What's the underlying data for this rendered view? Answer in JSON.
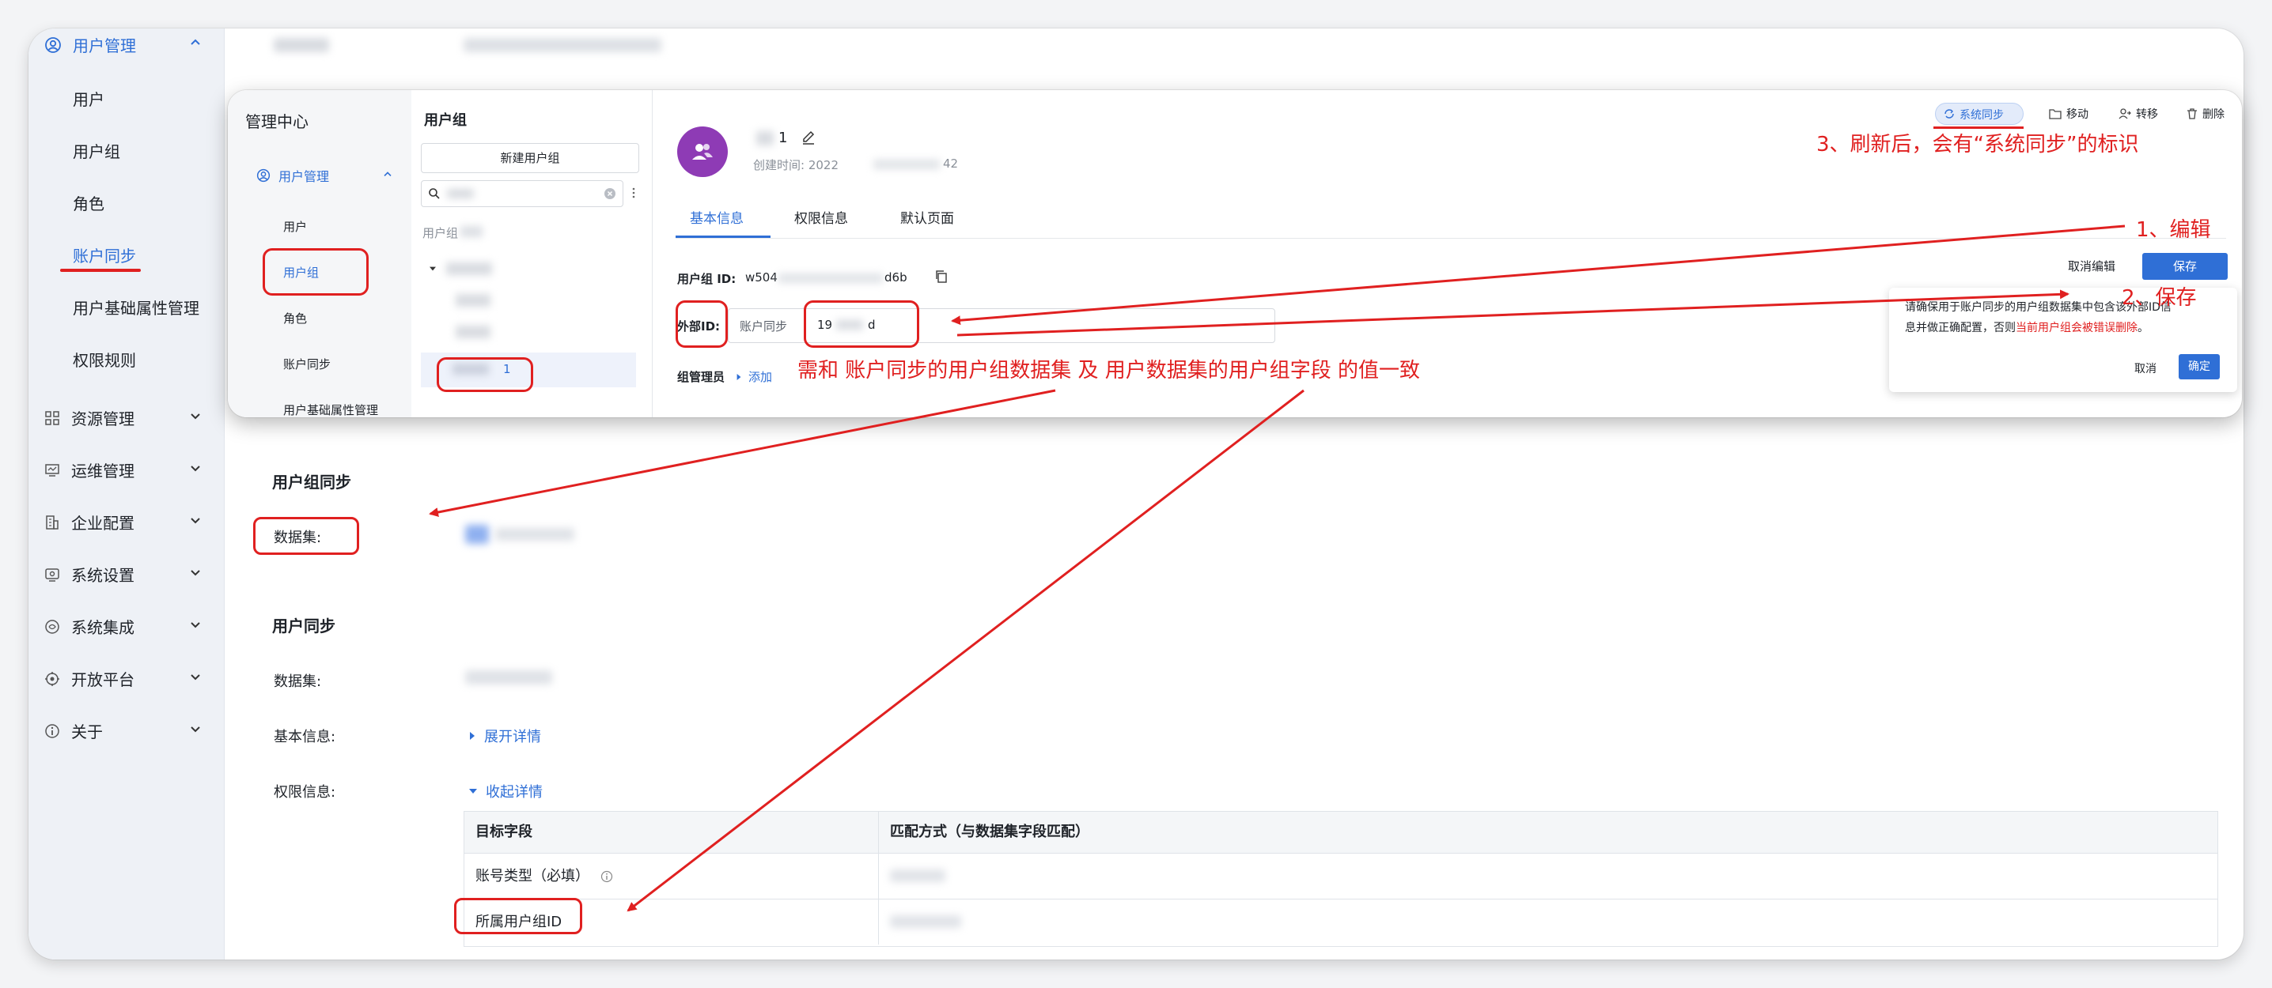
{
  "sidebar": {
    "sections": [
      {
        "label": "用户管理",
        "icon": "user-circle-icon",
        "expanded": true,
        "items": [
          {
            "label": "用户"
          },
          {
            "label": "用户组"
          },
          {
            "label": "角色"
          },
          {
            "label": "账户同步",
            "active": true
          },
          {
            "label": "用户基础属性管理"
          },
          {
            "label": "权限规则"
          }
        ]
      },
      {
        "label": "资源管理",
        "icon": "grid-icon"
      },
      {
        "label": "运维管理",
        "icon": "monitor-icon"
      },
      {
        "label": "企业配置",
        "icon": "building-icon"
      },
      {
        "label": "系统设置",
        "icon": "gear-icon"
      },
      {
        "label": "系统集成",
        "icon": "integration-icon"
      },
      {
        "label": "开放平台",
        "icon": "platform-icon"
      },
      {
        "label": "关于",
        "icon": "info-icon"
      }
    ]
  },
  "main": {
    "group_sync": {
      "title": "用户组同步",
      "dataset_label": "数据集:"
    },
    "user_sync": {
      "title": "用户同步",
      "dataset_label": "数据集:",
      "basic_info_label": "基本信息:",
      "basic_info_link": "展开详情",
      "permission_label": "权限信息:",
      "permission_link": "收起详情"
    },
    "table": {
      "headers": [
        "目标字段",
        "匹配方式（与数据集字段匹配）"
      ],
      "rows": [
        [
          "账号类型（必填）",
          ""
        ],
        [
          "所属用户组ID",
          ""
        ]
      ]
    }
  },
  "overlay": {
    "admin_title": "管理中心",
    "side_section": "用户管理",
    "side_items": [
      "用户",
      "用户组",
      "角色",
      "账户同步",
      "用户基础属性管理"
    ],
    "groups_title": "用户组",
    "new_group_button": "新建用户组",
    "group_tree_root": "用户组",
    "selected_group_suffix": "1",
    "group_name_suffix": "1",
    "created_label": "创建时间: 2022",
    "created_suffix": "42",
    "tabs": [
      "基本信息",
      "权限信息",
      "默认页面"
    ],
    "group_id_label": "用户组 ID:",
    "group_id_prefix": "w504",
    "group_id_suffix": "d6b",
    "external_id_label": "外部ID:",
    "external_source": "账户同步",
    "external_value_prefix": "19",
    "external_value_suffix": "d",
    "admins_label": "组管理员",
    "add_link": "添加",
    "sync_badge": "系统同步",
    "actions": [
      "移动",
      "转移",
      "删除"
    ],
    "cancel_edit": "取消编辑",
    "save": "保存",
    "popover_text_1": "请确保用于账户同步的用户组数据集中包含该外部ID信",
    "popover_text_2": "息并做正确配置，否则",
    "popover_warning": "当前用户组会被错误删除",
    "popover_end": "。",
    "popover_cancel": "取消",
    "popover_confirm": "确定"
  },
  "annotations": {
    "step1": "1、编辑",
    "step2": "2、保存",
    "step3": "3、刷新后，会有“系统同步”的标识",
    "note": "需和 账户同步的用户组数据集 及 用户数据集的用户组字段 的值一致"
  },
  "colors": {
    "accent": "#2f6fd6",
    "annotation": "#e02020",
    "avatar": "#8e3bb5"
  }
}
